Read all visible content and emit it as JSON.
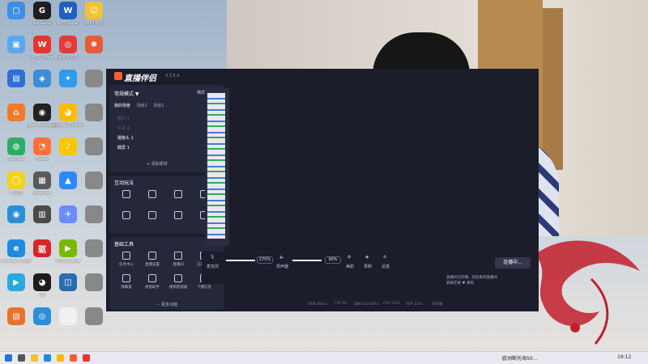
{
  "desktop": {
    "icons": [
      {
        "label": "",
        "color": "#3d8ee6",
        "glyph": "▢"
      },
      {
        "label": "WeGame",
        "color": "#1d1d1d",
        "glyph": "G"
      },
      {
        "label": "WPS[Beta]",
        "color": "#1f5fbf",
        "glyph": "W"
      },
      {
        "label": "WPS游戏",
        "color": "#f2c233",
        "glyph": "☺"
      },
      {
        "label": "",
        "color": "#5aa7f0",
        "glyph": "▣"
      },
      {
        "label": "WPS Office",
        "color": "#e8342c",
        "glyph": "W"
      },
      {
        "label": "网易云音乐",
        "color": "#e13b3b",
        "glyph": "◎"
      },
      {
        "label": "",
        "color": "#e85a3a",
        "glyph": "✺"
      },
      {
        "label": "",
        "color": "#2d6fd6",
        "glyph": "▤"
      },
      {
        "label": "",
        "color": "#3a8ed8",
        "glyph": "◈"
      },
      {
        "label": "",
        "color": "#2c9bf0",
        "glyph": "✦"
      },
      {
        "label": "",
        "color": "#888",
        "glyph": ""
      },
      {
        "label": "",
        "color": "#f07b2c",
        "glyph": "⌂"
      },
      {
        "label": "Open Broadcast",
        "color": "#222",
        "glyph": "◉"
      },
      {
        "label": "Google Chrome",
        "color": "#fbbc05",
        "glyph": "◕"
      },
      {
        "label": "",
        "color": "#888",
        "glyph": ""
      },
      {
        "label": "WeChat",
        "color": "#2aae67",
        "glyph": "◍"
      },
      {
        "label": "Firefox",
        "color": "#ff7139",
        "glyph": "◔"
      },
      {
        "label": "",
        "color": "#f5c800",
        "glyph": "♪"
      },
      {
        "label": "",
        "color": "#888",
        "glyph": ""
      },
      {
        "label": "YY语音",
        "color": "#f2d21b",
        "glyph": "◯"
      },
      {
        "label": "Minecraft",
        "color": "#5a5a5a",
        "glyph": "▦"
      },
      {
        "label": "",
        "color": "#2f87ff",
        "glyph": "▲"
      },
      {
        "label": "",
        "color": "#888",
        "glyph": ""
      },
      {
        "label": "",
        "color": "#2b8fd8",
        "glyph": "◉"
      },
      {
        "label": "",
        "color": "#4a4a4a",
        "glyph": "▥"
      },
      {
        "label": "",
        "color": "#6b8cff",
        "glyph": "✈"
      },
      {
        "label": "",
        "color": "#888",
        "glyph": ""
      },
      {
        "label": "Microsoft Edge",
        "color": "#1c8be0",
        "glyph": "e"
      },
      {
        "label": "",
        "color": "#d9252a",
        "glyph": "驱"
      },
      {
        "label": "NVIDIA App",
        "color": "#76b900",
        "glyph": "▶"
      },
      {
        "label": "",
        "color": "#888",
        "glyph": ""
      },
      {
        "label": "",
        "color": "#27a9e1",
        "glyph": "▶"
      },
      {
        "label": "QQ",
        "color": "#1d1d1d",
        "glyph": "◕"
      },
      {
        "label": "",
        "color": "#2b6cb0",
        "glyph": "◫"
      },
      {
        "label": "",
        "color": "#888",
        "glyph": ""
      },
      {
        "label": "",
        "color": "#e8742c",
        "glyph": "▤"
      },
      {
        "label": "",
        "color": "#2b8fd8",
        "glyph": "◎"
      },
      {
        "label": "",
        "color": "#f0f0f0",
        "glyph": ""
      },
      {
        "label": "",
        "color": "#888",
        "glyph": ""
      }
    ]
  },
  "app": {
    "title": "直播伴侣",
    "version": "4.3.5.4",
    "mode": {
      "label": "常规模式 ▼",
      "edit1": "横屏",
      "edit2": "竖屏"
    },
    "scene_tabs": [
      "我的场景",
      "场景2",
      "场景2"
    ],
    "sources": [
      {
        "label": "图片 1",
        "dim": true
      },
      {
        "label": "文本 4",
        "dim": true
      },
      {
        "label": "摄像头 1",
        "dim": false
      },
      {
        "label": "截屏 1",
        "dim": false
      }
    ],
    "add_source": "+ 添加素材",
    "interactive": {
      "title": "互动玩法",
      "tools": [
        "",
        "",
        "",
        "",
        "",
        "",
        "",
        ""
      ]
    },
    "basic_tools": {
      "title": "基础工具",
      "tools": [
        "任务中心",
        "直播设置",
        "直播间",
        "正在音乐",
        "弹幕窗",
        "视窗助手",
        "视频管理器",
        "下播信息"
      ]
    },
    "more": "··· 更多功能",
    "controls": {
      "mic_label": "麦克风",
      "mic_value": "170%",
      "speaker_label": "扬声器",
      "speaker_value": "90%",
      "beauty_label": "美颜",
      "record_label": "录制",
      "settings_label": "设置",
      "start_button": "连播中..."
    },
    "chat": {
      "line1": "直播间已开播，欢迎来到直播间",
      "line2": "新鲜芒果 ♥ 来啦"
    },
    "status": [
      "码率 0Kb/s",
      "FPS 30",
      "丢帧 0(0.00%)",
      "CPU 11%",
      "内存 23%",
      "未开播"
    ]
  },
  "taskbar": {
    "items": [
      "欧洲断托海50..."
    ],
    "time": "19:12"
  }
}
